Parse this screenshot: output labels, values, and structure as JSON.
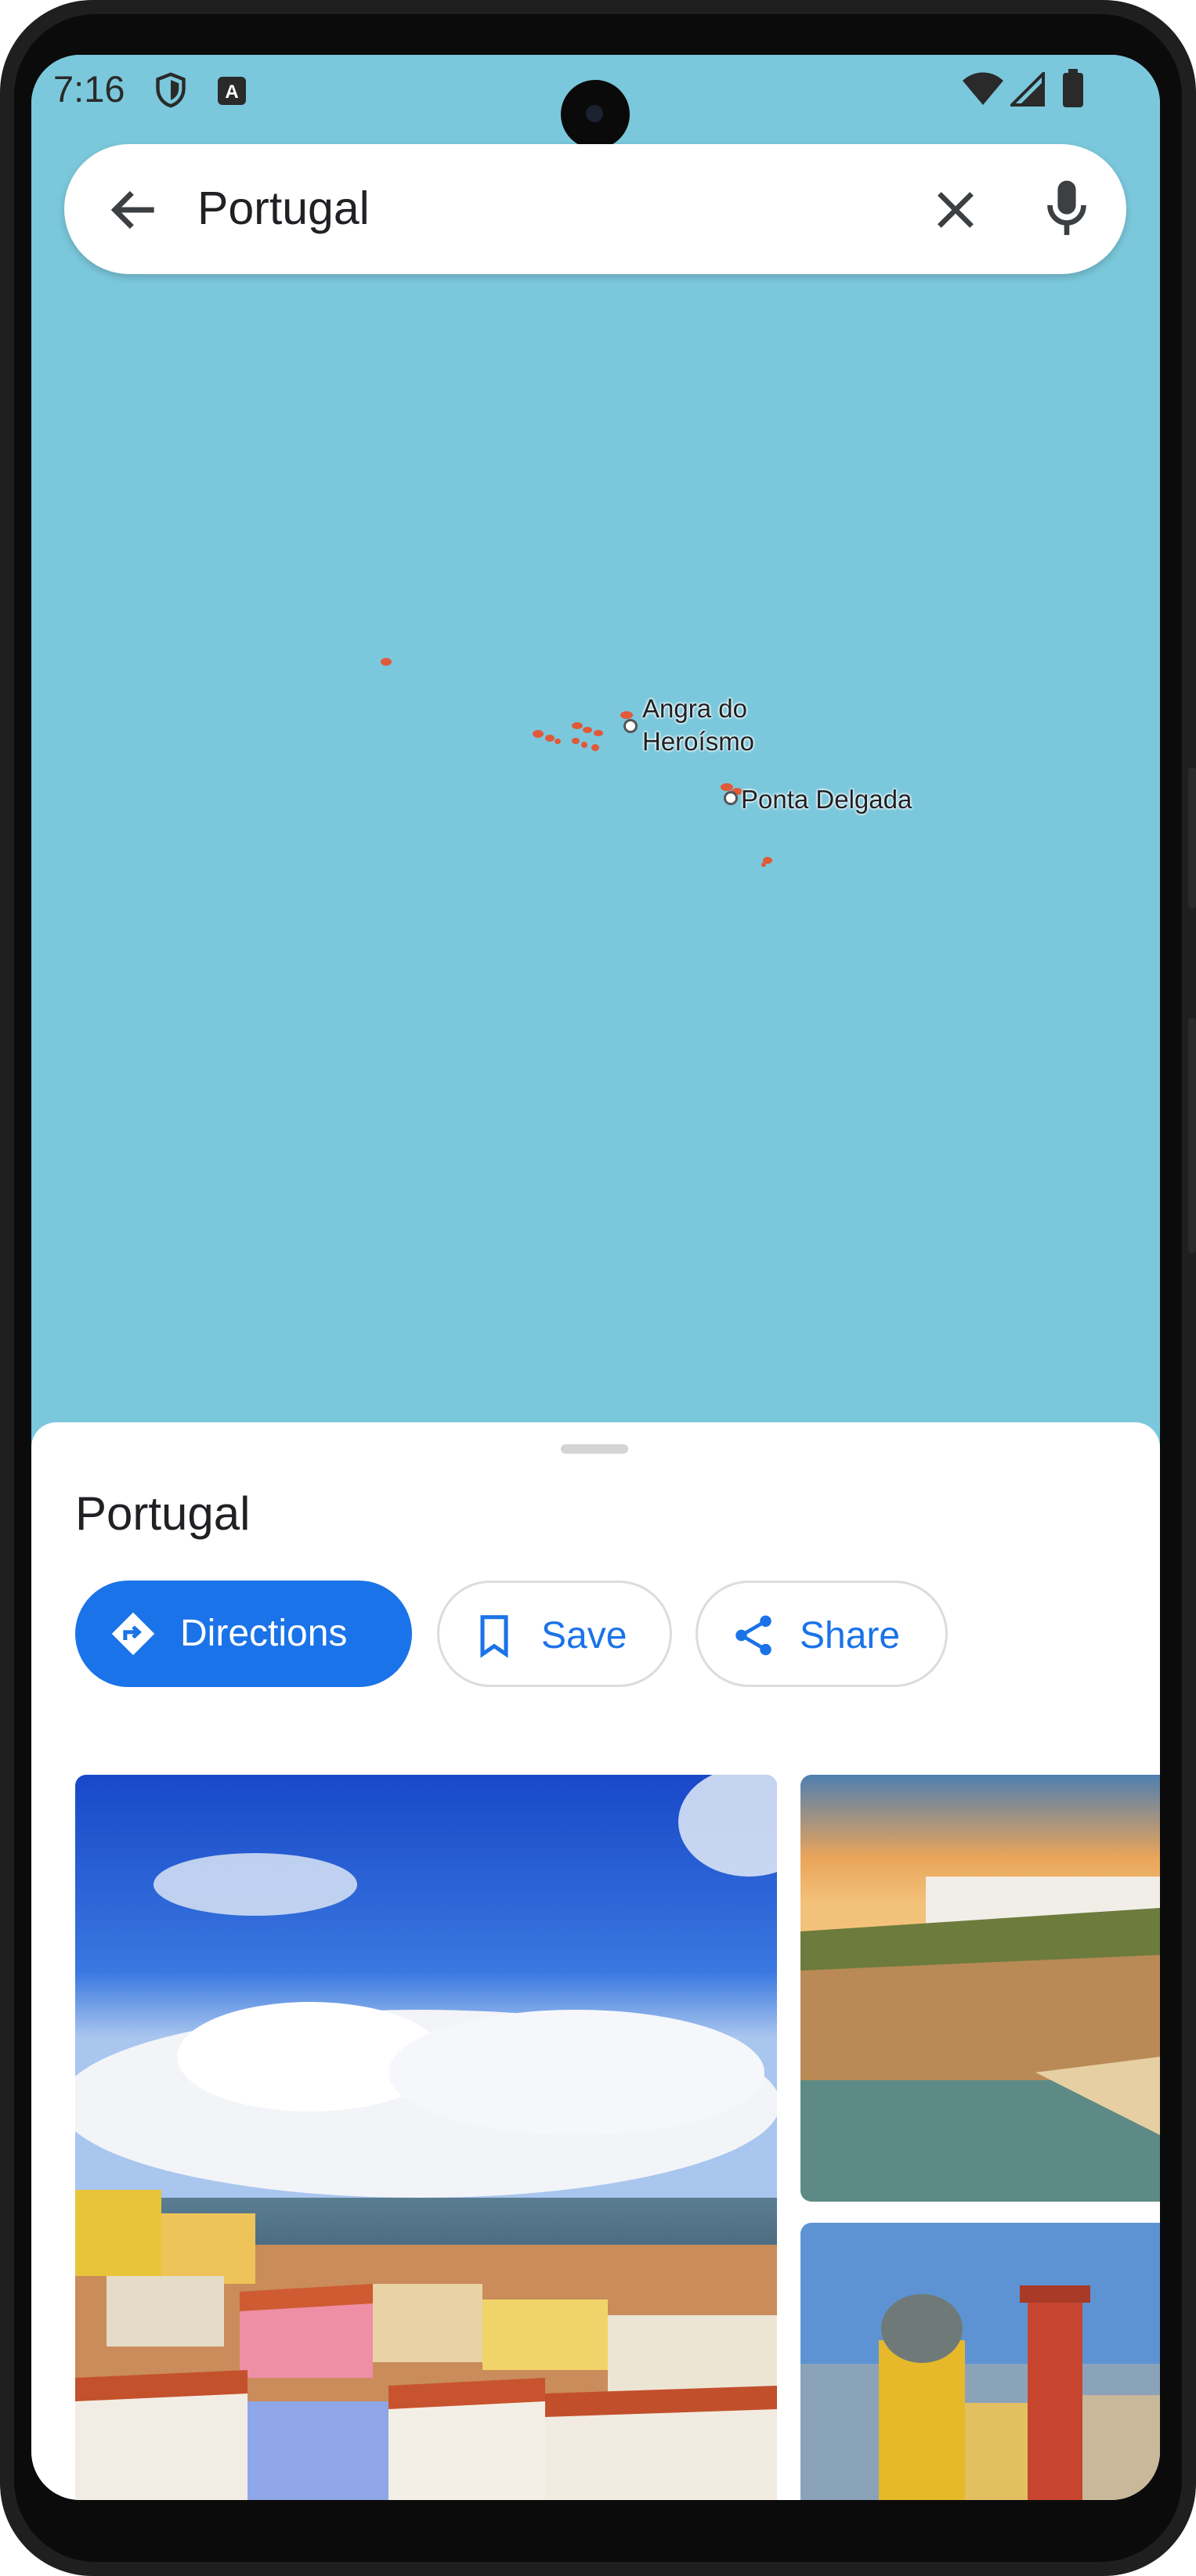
{
  "status_bar": {
    "time": "7:16",
    "left_icons": [
      "shield-icon",
      "translate-app-icon"
    ],
    "right_icons": [
      "wifi-icon",
      "signal-icon",
      "battery-icon"
    ]
  },
  "search": {
    "query": "Portugal",
    "back_icon": "arrow-back-icon",
    "clear_icon": "close-icon",
    "mic_icon": "microphone-icon"
  },
  "map": {
    "labels": {
      "angra_line1": "Angra do",
      "angra_line2": "Heroísmo",
      "ponta": "Ponta Delgada"
    },
    "colors": {
      "water": "#7bc8dc",
      "land": "#e05a3a"
    }
  },
  "place": {
    "title": "Portugal",
    "actions": {
      "directions": "Directions",
      "save": "Save",
      "share": "Share"
    },
    "photos": [
      "lisbon-cityscape-photo",
      "coastal-cliffs-photo",
      "pena-palace-photo"
    ]
  },
  "colors": {
    "accent": "#1a73e8"
  }
}
